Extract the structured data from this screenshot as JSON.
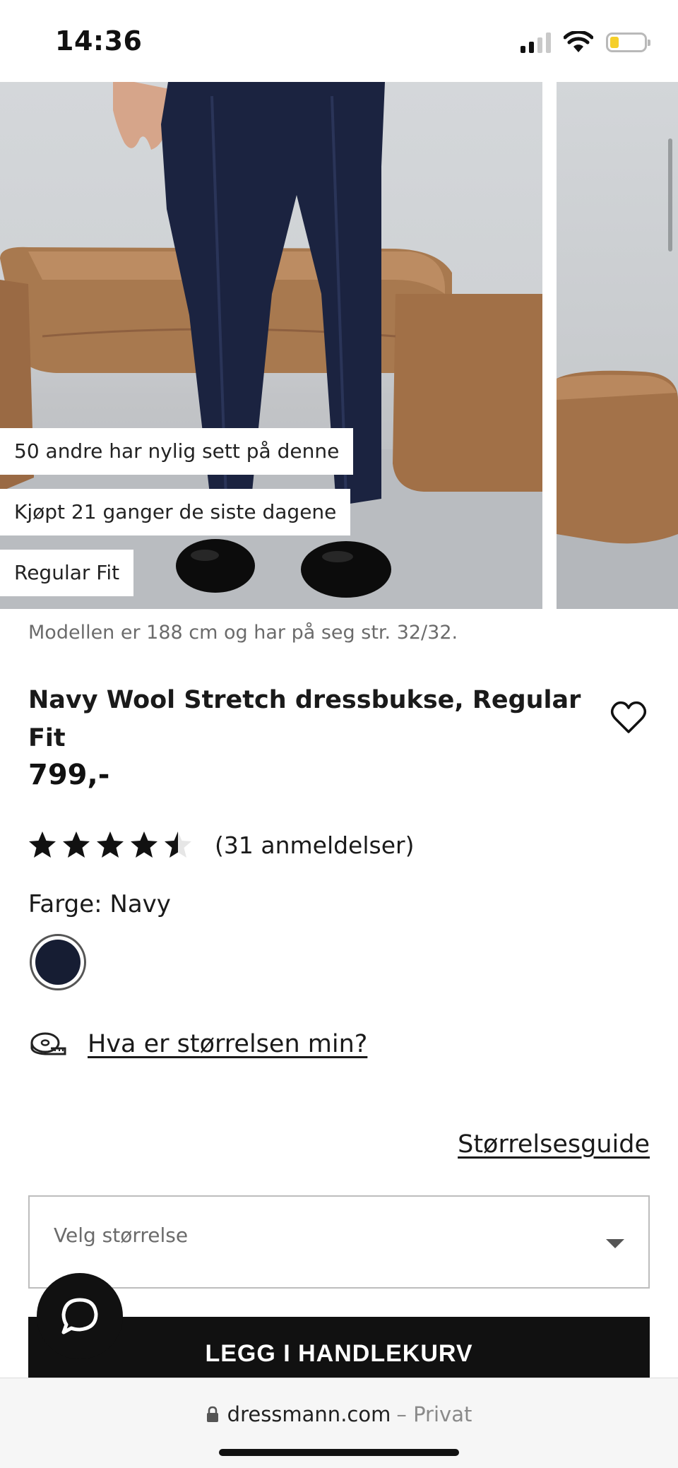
{
  "status_bar": {
    "time": "14:36",
    "battery_level_percent": 25,
    "battery_color": "#f5cf2a"
  },
  "badges": [
    "50 andre har nylig sett på denne",
    "Kjøpt 21 ganger de siste dagene",
    "Regular Fit"
  ],
  "product": {
    "model_note": "Modellen er 188 cm og har på seg str. 32/32.",
    "title": "Navy Wool Stretch dressbukse, Regular Fit",
    "price": "799,-",
    "rating": 4.5,
    "rating_max": 5,
    "review_count_label": "(31 anmeldelser)",
    "color_label": "Farge: Navy",
    "swatch_color": "#161d33"
  },
  "size": {
    "help_link": "Hva er størrelsen min?",
    "guide_link": "Størrelsesguide",
    "select_placeholder": "Velg størrelse"
  },
  "cta": {
    "add_to_cart": "LEGG I HANDLEKURV"
  },
  "browser": {
    "domain": "dressmann.com",
    "mode": "– Privat"
  },
  "icons": {
    "favorite": "heart-outline-icon",
    "chat": "chat-bubble-icon",
    "size_help": "measuring-tape-icon",
    "lock": "lock-icon"
  }
}
